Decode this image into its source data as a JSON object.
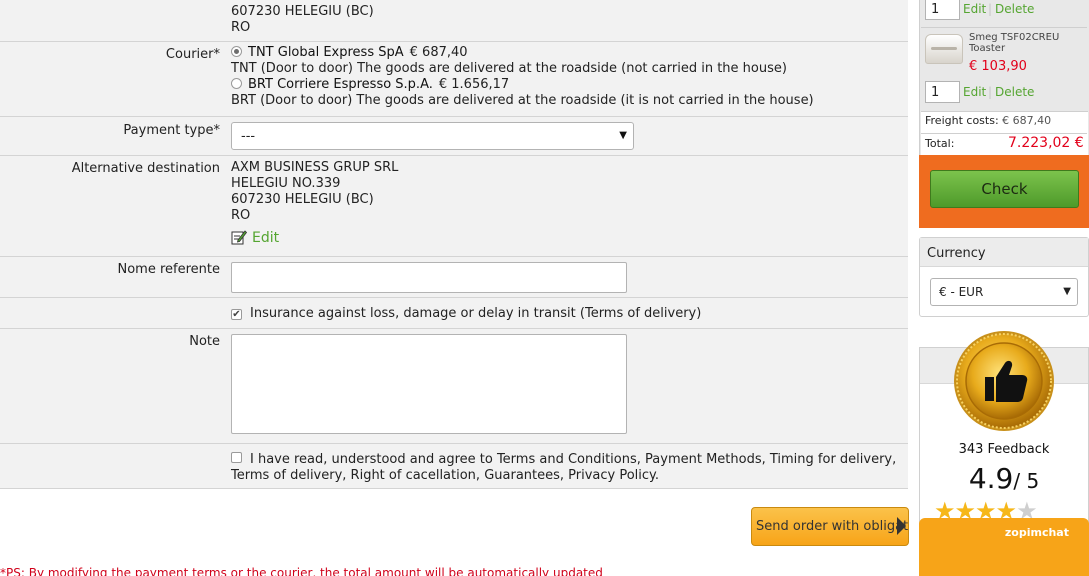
{
  "address_top": {
    "line1": "607230 HELEGIU (BC)",
    "line2": "RO"
  },
  "courier": {
    "label": "Courier*",
    "options": [
      {
        "name": "TNT Global Express SpA",
        "price": "€ 687,40",
        "desc": "TNT (Door to door) The goods are delivered at the roadside (not carried in the house)",
        "selected": true
      },
      {
        "name": "BRT Corriere Espresso S.p.A.",
        "price": "€ 1.656,17",
        "desc": "BRT (Door to door) The goods are delivered at the roadside (it is not carried in the house)",
        "selected": false
      }
    ]
  },
  "payment": {
    "label": "Payment type*",
    "selected": "---"
  },
  "alt_destination": {
    "label": "Alternative destination",
    "lines": [
      "AXM BUSINESS GRUP SRL",
      "HELEGIU NO.339",
      "607230 HELEGIU (BC)",
      "RO"
    ],
    "edit_label": "Edit"
  },
  "referent": {
    "label": "Nome referente",
    "value": ""
  },
  "insurance": {
    "checked": true,
    "label": "Insurance against loss, damage or delay in transit (Terms of delivery)"
  },
  "note": {
    "label": "Note",
    "value": ""
  },
  "terms": {
    "checked": false,
    "line1": "I have read, understood and agree to Terms and Conditions, Payment Methods, Timing for delivery,",
    "line2": "Terms of delivery, Right of cacellation, Guarantees, Privacy Policy."
  },
  "send_button": "Send order with obligatio",
  "ps_note": "*PS: By modifying the payment terms or the courier, the total amount will be automatically updated",
  "cart": {
    "items": [
      {
        "qty": "1",
        "edit": "Edit",
        "delete": "Delete"
      },
      {
        "name": "Smeg TSF02CREU Toaster",
        "price": "€ 103,90",
        "qty": "1",
        "edit": "Edit",
        "delete": "Delete"
      }
    ],
    "freight_label": "Freight costs:",
    "freight_value": "€ 687,40",
    "total_label": "Total:",
    "total_value": "7.223,02 €",
    "check_button": "Check"
  },
  "currency": {
    "title": "Currency",
    "selected": "€ - EUR"
  },
  "feedback": {
    "count": "343 Feedback",
    "score": "4.9",
    "out_of": "/ 5",
    "rating": 4.9,
    "medal_icon": "thumbs-up-medal-icon"
  },
  "chat": {
    "brand": "zopimchat"
  },
  "colors": {
    "accent_green": "#55a531",
    "price_red": "#e2001a",
    "orange": "#ef6c1f",
    "button_orange": "#f7a418"
  }
}
